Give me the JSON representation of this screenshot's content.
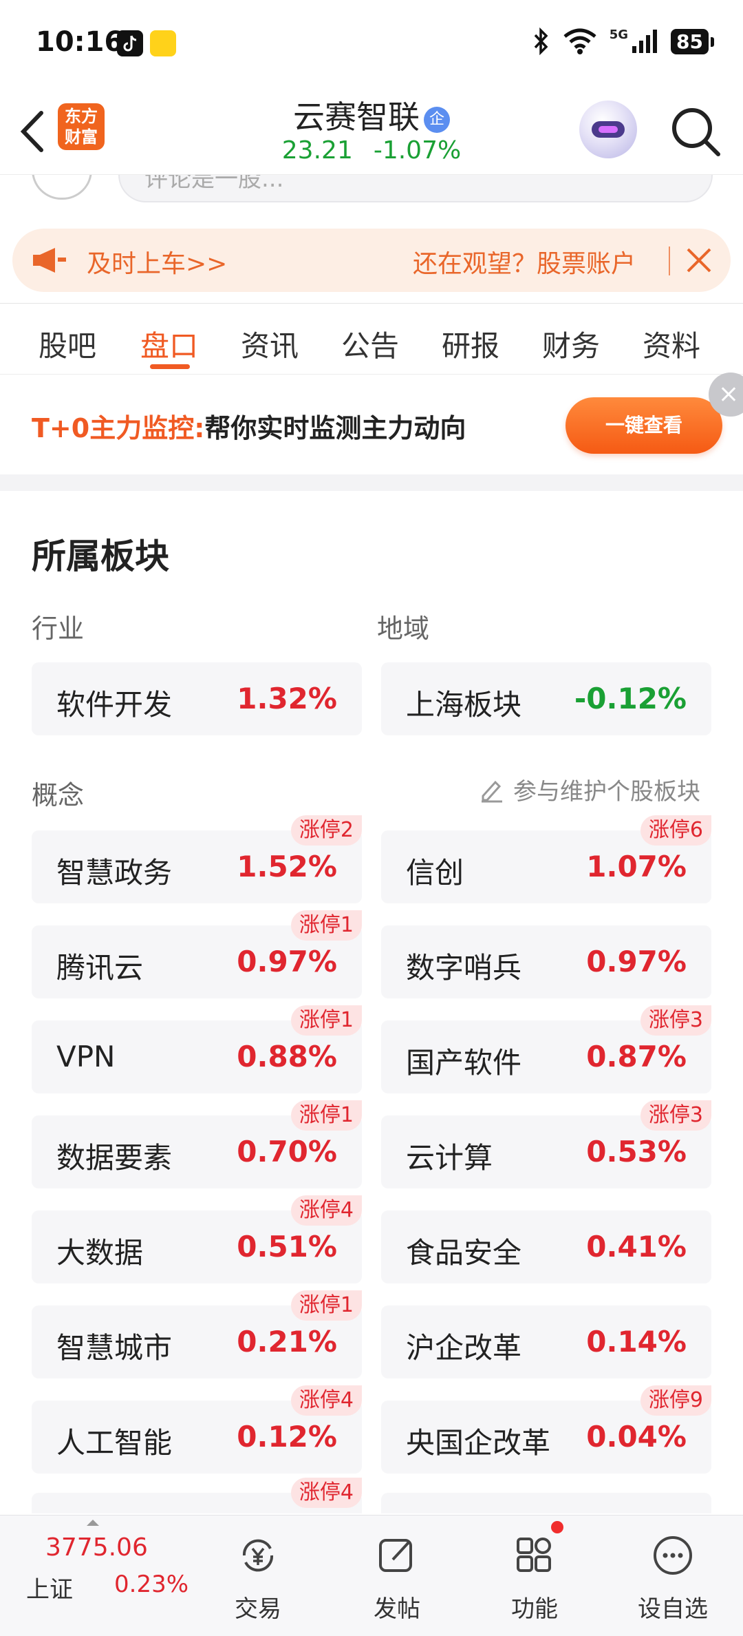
{
  "status_bar": {
    "time": "10:16",
    "network": "5G",
    "battery": "85"
  },
  "header": {
    "logo_text": "东方财富",
    "stock_name": "云赛智联",
    "badge": "企",
    "price": "23.21",
    "change": "-1.07%"
  },
  "search_peek": {
    "placeholder": "评论是一股..."
  },
  "notice": {
    "left_text": "及时上车>>",
    "right_text": "还在观望？股票账户"
  },
  "tabs": [
    "股吧",
    "盘口",
    "资讯",
    "公告",
    "研报",
    "财务",
    "资料"
  ],
  "promo": {
    "highlight": "T+0主力监控:",
    "text": "帮你实时监测主力动向",
    "button": "一键查看"
  },
  "sectors": {
    "title": "所属板块",
    "industry_label": "行业",
    "region_label": "地域",
    "concept_label": "概念",
    "maintain_label": "参与维护个股板块",
    "industry": {
      "name": "软件开发",
      "pct": "1.32%"
    },
    "region": {
      "name": "上海板块",
      "pct": "-0.12%"
    },
    "concepts": [
      {
        "name": "智慧政务",
        "pct": "1.52%",
        "tag": "涨停2"
      },
      {
        "name": "信创",
        "pct": "1.07%",
        "tag": "涨停6"
      },
      {
        "name": "腾讯云",
        "pct": "0.97%",
        "tag": "涨停1"
      },
      {
        "name": "数字哨兵",
        "pct": "0.97%",
        "tag": ""
      },
      {
        "name": "VPN",
        "pct": "0.88%",
        "tag": "涨停1"
      },
      {
        "name": "国产软件",
        "pct": "0.87%",
        "tag": "涨停3"
      },
      {
        "name": "数据要素",
        "pct": "0.70%",
        "tag": "涨停1"
      },
      {
        "name": "云计算",
        "pct": "0.53%",
        "tag": "涨停3"
      },
      {
        "name": "大数据",
        "pct": "0.51%",
        "tag": "涨停4"
      },
      {
        "name": "食品安全",
        "pct": "0.41%",
        "tag": ""
      },
      {
        "name": "智慧城市",
        "pct": "0.21%",
        "tag": "涨停1"
      },
      {
        "name": "沪企改革",
        "pct": "0.14%",
        "tag": ""
      },
      {
        "name": "人工智能",
        "pct": "0.12%",
        "tag": "涨停4"
      },
      {
        "name": "央国企改革",
        "pct": "0.04%",
        "tag": "涨停9"
      }
    ],
    "partial_tag": "涨停4"
  },
  "bottom_nav": {
    "index_value": "3775.06",
    "index_name": "上证",
    "index_pct": "0.23%",
    "items": [
      "交易",
      "发帖",
      "功能",
      "设自选"
    ]
  },
  "colors": {
    "accent": "#f05a23",
    "up": "#e0262f",
    "down": "#1aa034"
  }
}
